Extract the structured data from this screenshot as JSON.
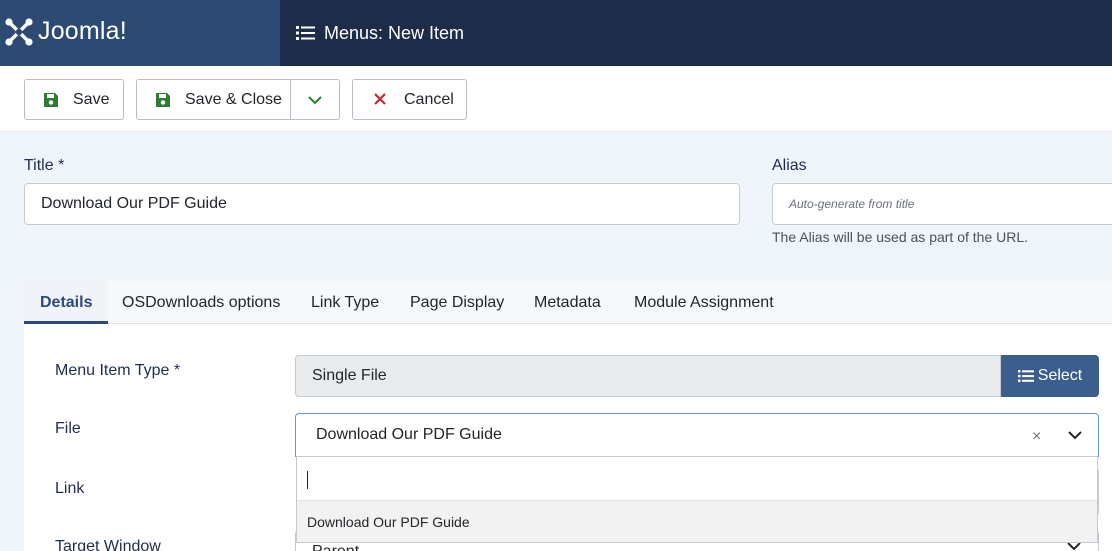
{
  "brand": {
    "name": "Joomla!"
  },
  "header": {
    "title": "Menus: New Item"
  },
  "toolbar": {
    "save_label": "Save",
    "save_close_label": "Save & Close",
    "cancel_label": "Cancel"
  },
  "form": {
    "title_label": "Title *",
    "title_value": "Download Our PDF Guide",
    "alias_label": "Alias",
    "alias_placeholder": "Auto-generate from title",
    "alias_help": "The Alias will be used as part of the URL."
  },
  "tabs": [
    {
      "label": "Details",
      "active": true
    },
    {
      "label": "OSDownloads options"
    },
    {
      "label": "Link Type"
    },
    {
      "label": "Page Display"
    },
    {
      "label": "Metadata"
    },
    {
      "label": "Module Assignment"
    }
  ],
  "details": {
    "menu_item_type_label": "Menu Item Type *",
    "menu_item_type_value": "Single File",
    "select_label": "Select",
    "file_label": "File",
    "file_value": "Download Our PDF Guide",
    "file_clear": "×",
    "file_search_value": "",
    "file_options": [
      "Download Our PDF Guide"
    ],
    "link_label": "Link",
    "target_window_label": "Target Window",
    "target_window_value": "Parent"
  },
  "colors": {
    "header_bg": "#1c2c49",
    "logo_bg": "#2d4a73",
    "accent": "#3c5e8c",
    "save_icon": "#2f7d32",
    "cancel_icon": "#c52827"
  }
}
